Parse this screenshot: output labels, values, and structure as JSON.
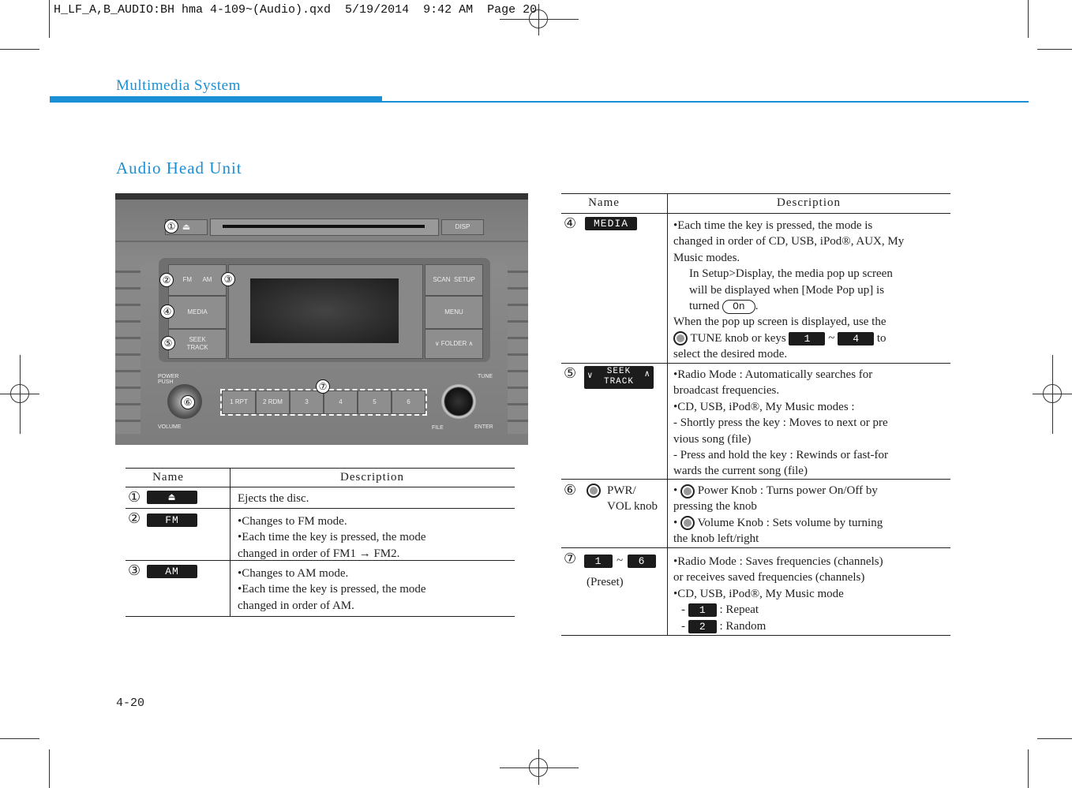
{
  "slug": "H_LF_A,B_AUDIO:BH hma 4-109~(Audio).qxd  5/19/2014  9:42 AM  Page 20",
  "section": "Multimedia System",
  "title": "Audio Head Unit",
  "accent_color": "#1a8fd6",
  "page_number": "4-20",
  "radio": {
    "eject": "⏏",
    "disp": "DISP",
    "fm": "FM",
    "am": "AM",
    "media": "MEDIA",
    "seek": "SEEK",
    "track": "TRACK",
    "scan": "SCAN",
    "setup": "SETUP",
    "menu": "MENU",
    "folder": "∨ FOLDER ∧",
    "power": "POWER",
    "push": "PUSH",
    "volume": "VOLUME",
    "tune": "TUNE",
    "file": "FILE",
    "enter": "ENTER",
    "presets": [
      "1 RPT",
      "2 RDM",
      "3",
      "4",
      "5",
      "6"
    ],
    "callouts": [
      "①",
      "②",
      "③",
      "④",
      "⑤",
      "⑥",
      "⑦"
    ]
  },
  "left_table": {
    "headers": [
      "Name",
      "Description"
    ],
    "rows": [
      {
        "num": "①",
        "key": "⏏",
        "lines": [
          "Ejects the disc."
        ]
      },
      {
        "num": "②",
        "key": "FM",
        "lines": [
          "•Changes to FM mode.",
          "•Each time the key is pressed, the mode",
          "changed in order of FM1 → FM2."
        ]
      },
      {
        "num": "③",
        "key": "AM",
        "lines": [
          "•Changes to AM mode.",
          "•Each time the key is pressed, the mode",
          "changed in order of AM."
        ]
      }
    ]
  },
  "right_table": {
    "headers": [
      "Name",
      "Description"
    ],
    "r4": {
      "num": "④",
      "key": "MEDIA",
      "l1": "•Each time the key is pressed, the mode is",
      "l2": "changed in order of CD, USB, iPod®, AUX, My",
      "l3": "Music modes.",
      "l4": "In Setup>Display, the media pop up screen",
      "l5": "will be displayed when [Mode Pop up] is",
      "l6a": "turned",
      "on": "On",
      "l6b": ".",
      "l7": "When the pop up screen is displayed, use the",
      "l8a": "TUNE knob or keys",
      "k1": "1",
      "tilde": "~",
      "k4": "4",
      "l8b": "to",
      "l9": "select the desired mode."
    },
    "r5": {
      "num": "⑤",
      "seek": "SEEK",
      "track": "TRACK",
      "lines": [
        "•Radio Mode : Automatically searches for",
        "broadcast frequencies.",
        "•CD, USB, iPod®, My Music modes :",
        "- Shortly press the key : Moves to next or pre",
        "vious song (file)",
        "- Press and hold the key : Rewinds or fast-for",
        "wards the current song (file)"
      ]
    },
    "r6": {
      "num": "⑥",
      "name1": "PWR/",
      "name2": "VOL knob",
      "l1": "Power Knob : Turns power On/Off by",
      "l2": "pressing the knob",
      "l3": "Volume Knob : Sets volume by turning",
      "l4": "the knob left/right"
    },
    "r7": {
      "num": "⑦",
      "k1": "1",
      "tilde": "~",
      "k6": "6",
      "preset": "(Preset)",
      "l1": "•Radio Mode : Saves frequencies (channels)",
      "l2": "or receives saved frequencies (channels)",
      "l3": "•CD, USB, iPod®, My Music mode",
      "rk1": "1",
      "repeat": ": Repeat",
      "rk2": "2",
      "random": ": Random",
      "dash": "-"
    }
  }
}
